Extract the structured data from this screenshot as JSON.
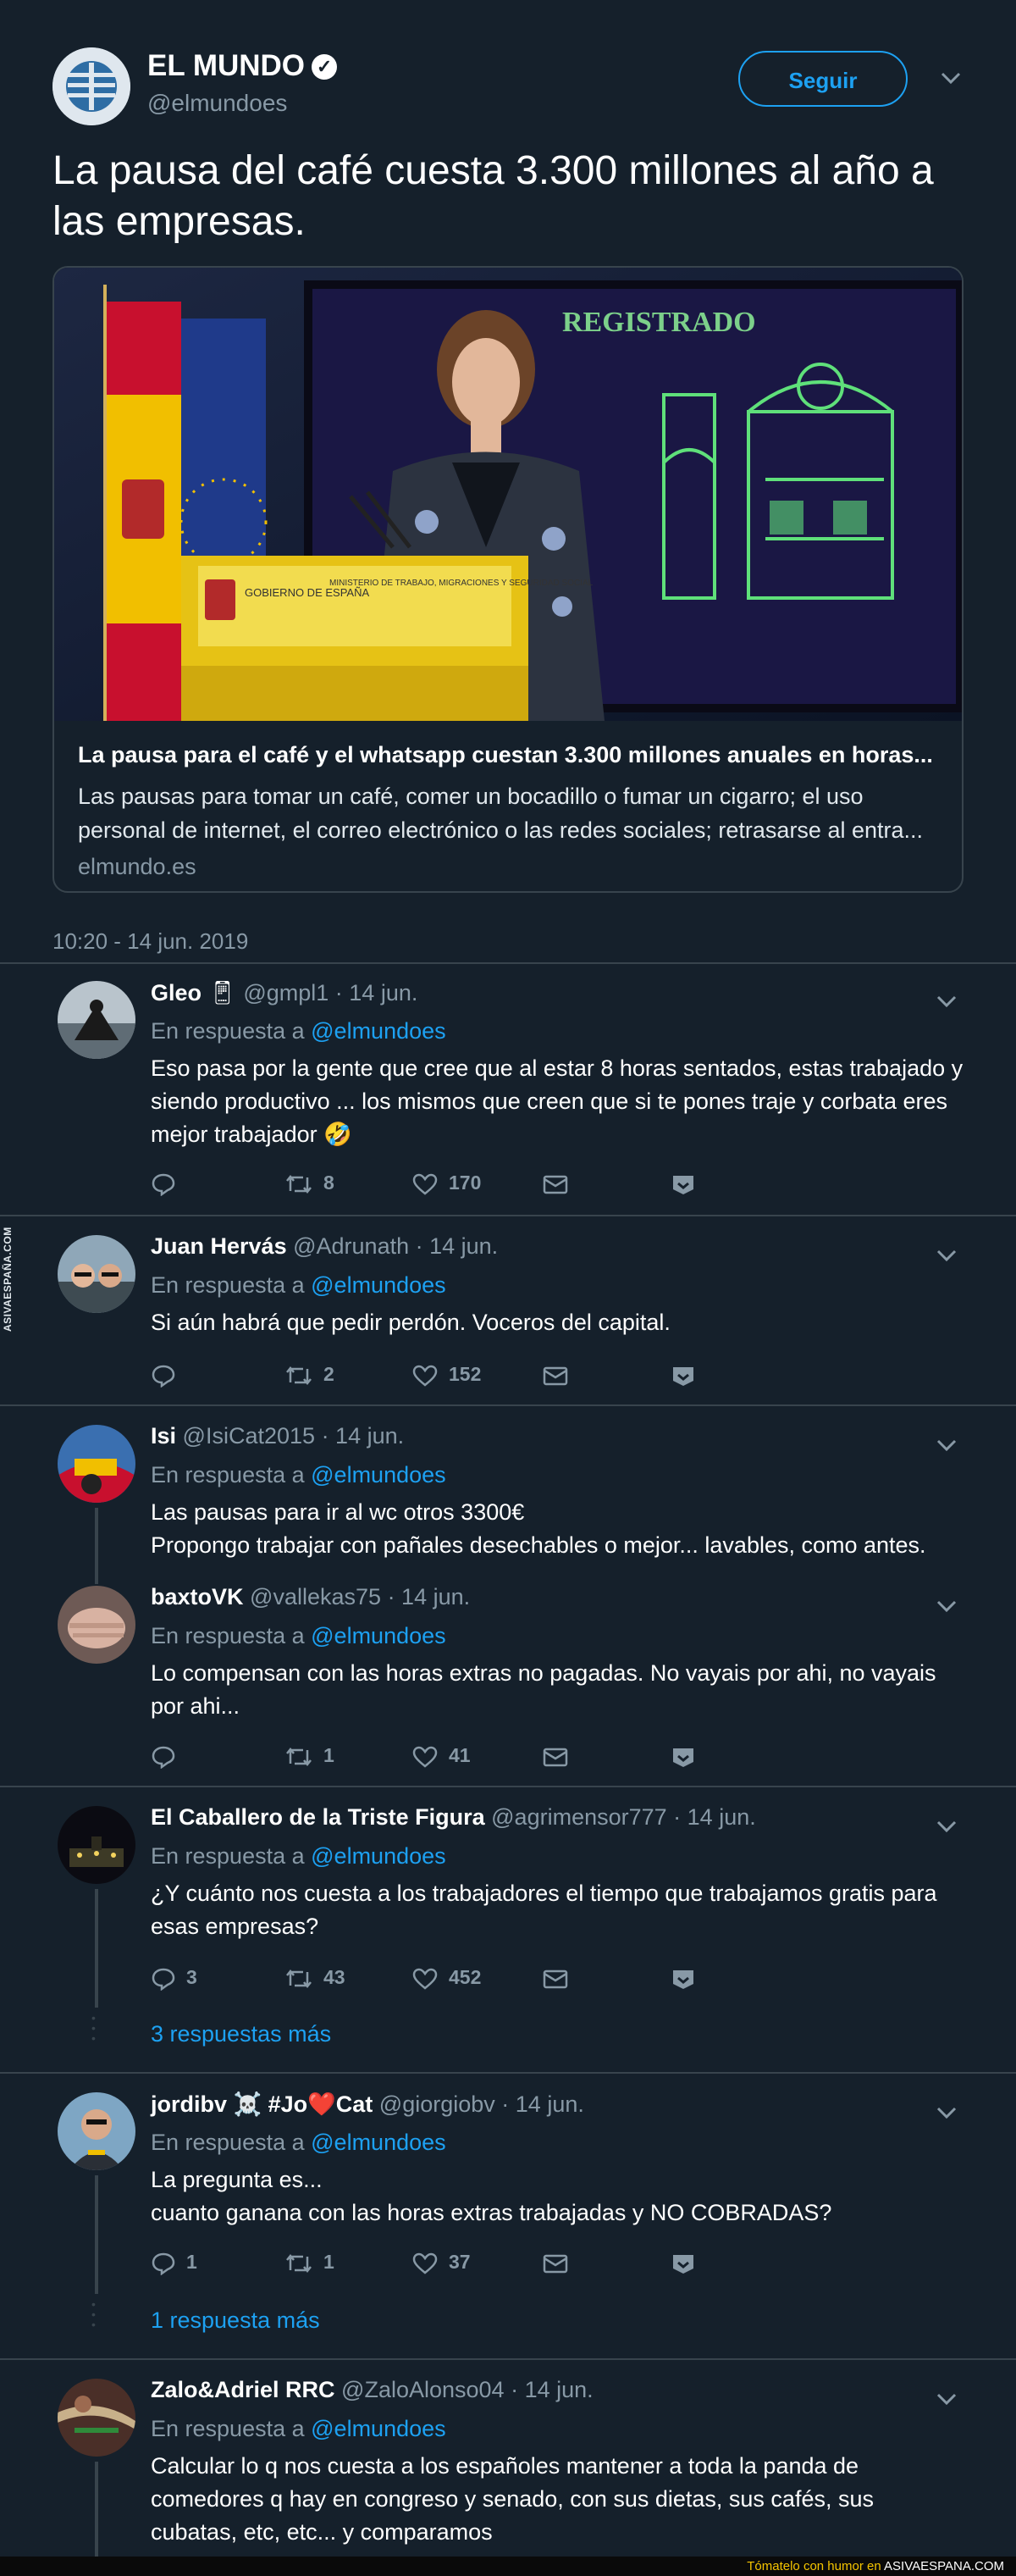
{
  "watermark_side": "ASIVAESPAÑA.COM",
  "main_tweet": {
    "author_name": "EL MUNDO",
    "author_handle": "@elmundoes",
    "follow_label": "Seguir",
    "text": "La pausa del café cuesta 3.300 millones al año a las empresas.",
    "card": {
      "image_text_gobierno": "GOBIERNO DE ESPAÑA",
      "image_text_ministerio": "MINISTERIO DE TRABAJO, MIGRACIONES Y SEGURIDAD SOCIAL",
      "image_text_screen": "REGISTRADO",
      "title": "La pausa para el café y el whatsapp cuestan 3.300 millones anuales en horas...",
      "description": "Las pausas para tomar un café, comer un bocadillo o fumar un cigarro; el uso personal de internet, el correo electrónico o las redes sociales; retrasarse al entra...",
      "domain": "elmundo.es"
    },
    "timestamp": "10:20 - 14 jun. 2019"
  },
  "in_reply_prefix": "En respuesta a",
  "in_reply_mention": "@elmundoes",
  "replies": [
    {
      "name": "Gleo",
      "handle": "@gmpl1",
      "date": "· 14 jun.",
      "text": "Eso pasa por la gente que cree que al estar 8 horas sentados, estas trabajado y siendo productivo ... los mismos que creen que si te pones traje y corbata eres mejor trabajador 🤣",
      "replies": "",
      "retweets": "8",
      "likes": "170"
    },
    {
      "name": "Juan Hervás",
      "handle": "@Adrunath",
      "date": "· 14 jun.",
      "text": "Si aún habrá que pedir perdón. Voceros del capital.",
      "replies": "",
      "retweets": "2",
      "likes": "152"
    },
    {
      "name": "Isi",
      "handle": "@IsiCat2015",
      "date": "· 14 jun.",
      "text_line1": "Las pausas para ir al wc otros 3300€",
      "text_line2": "Propongo trabajar con pañales desechables o mejor... lavables, como antes."
    },
    {
      "name": "baxtoVK",
      "handle": "@vallekas75",
      "date": "· 14 jun.",
      "text": "Lo compensan con las horas extras no pagadas. No vayais por ahi, no vayais por ahi...",
      "replies": "",
      "retweets": "1",
      "likes": "41"
    },
    {
      "name": "El Caballero de la Triste Figura",
      "handle": "@agrimensor777",
      "date": "· 14 jun.",
      "text": "¿Y cuánto nos cuesta a los trabajadores el tiempo que trabajamos gratis para esas empresas?",
      "replies": "3",
      "retweets": "43",
      "likes": "452",
      "more": "3 respuestas más"
    },
    {
      "name": "jordibv ☠️ #Jo❤️Cat",
      "handle": "@giorgiobv",
      "date": "· 14 jun.",
      "text_line1": "La pregunta es...",
      "text_line2": "cuanto ganana con las horas extras trabajadas y NO COBRADAS?",
      "replies": "1",
      "retweets": "1",
      "likes": "37",
      "more": "1 respuesta más"
    },
    {
      "name": "Zalo&Adriel RRC",
      "handle": "@ZaloAlonso04",
      "date": "· 14 jun.",
      "text": "Calcular lo q nos cuesta a los españoles mantener a toda la panda de comedores q hay en congreso y senado, con sus dietas, sus cafés, sus cubatas, etc, etc... y comparamos"
    }
  ],
  "bottom_bar": {
    "text1": "Tómatelo con humor en",
    "text2": "ASIVAESPANA.COM"
  },
  "colors": {
    "background": "#15202b",
    "accent": "#1da1f2",
    "muted": "#8899a6",
    "divider": "#38444d"
  }
}
